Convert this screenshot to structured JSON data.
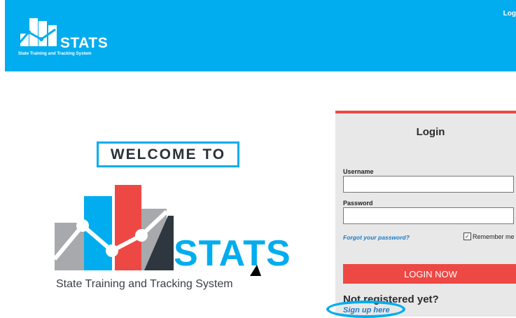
{
  "header": {
    "logo_text": "STATS",
    "logo_subtitle": "State Training and Tracking System",
    "login_link": "Log"
  },
  "welcome": {
    "heading": "WELCOME TO",
    "logo_text": "STATS",
    "tagline": "State Training and Tracking System"
  },
  "login": {
    "title": "Login",
    "username_label": "Username",
    "username_value": "",
    "password_label": "Password",
    "password_value": "",
    "forgot_password": "Forgot your password?",
    "remember_me": "Remember me",
    "remember_checked": true,
    "submit": "LOGIN NOW",
    "not_registered": "Not registered yet?",
    "signup": "Sign up here"
  },
  "colors": {
    "header_bg": "#01adef",
    "accent_red": "#ee4845",
    "link_blue": "#1d7bc4",
    "panel_bg": "#e8e8e8",
    "logo_gray": "#a7a9ac",
    "logo_dark": "#2e3740"
  }
}
